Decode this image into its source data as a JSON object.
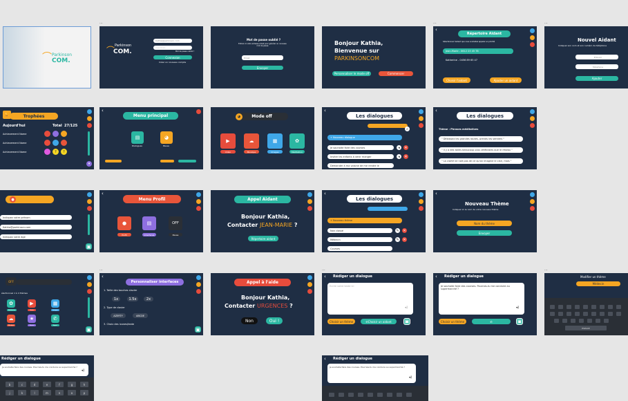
{
  "f1": {
    "logo_top": "Parkinson",
    "logo_bottom": "COM."
  },
  "f2": {
    "logo_top": "Parkinson",
    "logo_bottom": "COM.",
    "email": "Kathia@parkinson.com",
    "password": "••••••••",
    "forgot": "Mot de passe oublié ?",
    "login": "Connexion",
    "create": "Créer un nouveau compte"
  },
  "f3": {
    "title": "Mot de passe oublié ?",
    "sub": "Entrez ici votre adresse email pour générer un nouveau mot de passe",
    "email": "Email",
    "send": "Envoyer"
  },
  "f4": {
    "line1": "Bonjour Kathia,",
    "line2": "Bienvenue sur",
    "line3": "PARKINSONCOM",
    "btn1": "Personnaliser le mode off",
    "btn2": "Commencer"
  },
  "f5": {
    "title": "Répertoire Aidant",
    "sub": "Sélectionnez l'aidant que vous souhaitez appeler en priorité",
    "c1": "Jean-Marie - 0612 23 45 78",
    "c2": "Katherine - 0456 89 65 47",
    "choose": "Choisir l'aidant",
    "add": "Ajouter un aidant"
  },
  "f6": {
    "title": "Nouvel Aidant",
    "sub": "Indiquez son nom et son numéro de téléphone",
    "ph_name": "Prénom",
    "ph_phone": "Téléphone",
    "add": "Ajouter"
  },
  "f7": {
    "title": "Trophées",
    "today": "Aujourd'hui",
    "total": "Total",
    "count": "27/125",
    "a1": "Achievement Name",
    "a2": "Achievement Name",
    "a3": "Achievement Name"
  },
  "f8": {
    "title": "Menu principal",
    "b1": "Dialogues",
    "b2": "Pause"
  },
  "f9": {
    "title": "Mode off",
    "i1": "Vidéo",
    "i2": "Musique",
    "i3": "Images",
    "i4": "Méditation"
  },
  "f10": {
    "title": "Les dialogues",
    "new": "+ Nouveau dialogue",
    "r1": "Je souhaite faire des courses",
    "r2": "Inviter les enfants à venir manger",
    "r3": "Demander à ma voisine de me rendre le"
  },
  "f11": {
    "title": "Les dialogues",
    "theme": "Thème : Phrases méditatives",
    "q1": "\" Délaissez les grandes routes, prends les sentiers \"",
    "q2": "\" Il y a des toiles beaucoup plus cérébrales que le réseau \"",
    "q3": "\" La clarté ne naît pas de ce qu'on imagine le clair, mais \""
  },
  "f12": {
    "p1": "Indiquez votre prénom",
    "p2": "Kathia@parkinson.com",
    "p3": "Indiquez votre âge"
  },
  "f13": {
    "title": "Menu Profil",
    "b1": "Profil",
    "b2": "Interfaces",
    "b3": "Pause"
  },
  "f14": {
    "title": "Appel Aidant",
    "l1": "Bonjour Kathia,",
    "l2a": "Contacter ",
    "l2b": "JEAN-MARIE",
    "l2c": " ?",
    "btn": "Répertoire aidant"
  },
  "f15": {
    "title": "Les dialogues",
    "new": "+ Nouveau thème",
    "r1": "Non classé",
    "r2": "Médecin",
    "r3": "Courses"
  },
  "f16": {
    "title": "Nouveau Thème",
    "sub": "Indiquez ici le nom de votre nouveau thème",
    "name": "Nom du thème",
    "send": "Envoyer"
  },
  "f17": {
    "off": "OFF",
    "sub": "électionnez 1 à 4 thèmes",
    "i1": "Méditation",
    "i2": "Vidéo",
    "i3": "Images",
    "i4": "Musique",
    "i5": "Pause",
    "i6": "Appel"
  },
  "f18": {
    "title": "Personnaliser interfaces",
    "s1": "1. Taille des touches clavier",
    "o1": "1x",
    "o2": "1.5x",
    "o3": "2x",
    "s2": "2. Type de clavier",
    "k1": "AZERTY",
    "k2": "ABCDE",
    "s3": "3. Choix des icones/texte"
  },
  "f19": {
    "title": "Appel à l'aide",
    "l1": "Bonjour Kathia,",
    "l2a": "Contacter ",
    "l2b": "URGENCES",
    "l2c": " ?",
    "no": "Non",
    "yes": "Oui !"
  },
  "f20": {
    "title": "Rédiger un dialogue",
    "ph": "Ecrire votre texte ici",
    "theme": "Choisir un thème",
    "aid": "Choisir un aidant"
  },
  "f21": {
    "title": "Rédiger un dialogue",
    "text": "Je souhaite faire des courses. Pourrais-tu me conduire au supermarché ?",
    "theme": "Choisir un thème"
  },
  "f22": {
    "title": "Modifier un thème",
    "value": "Médecin",
    "space": "ESPACE"
  },
  "f23": {
    "title": "Rédiger un dialogue",
    "text": "Je souhaite faire des courses. Pourrais-tu me conduire au supermarché ?",
    "keys": [
      "b",
      "c",
      "d",
      "e",
      "f",
      "g",
      "h",
      "j",
      "k",
      "l",
      "m",
      "n",
      "o",
      "p"
    ]
  },
  "f24": {
    "title": "Rédiger un dialogue",
    "text": "Je souhaite faire des courses. Pourrais-tu me conduire au supermarché ?"
  },
  "colors": {
    "navy": "#1f2e44",
    "orange": "#f5a623",
    "teal": "#2bb7a2",
    "red": "#e74c3c",
    "purple": "#8e6fe0",
    "blue": "#3fa7e8"
  }
}
